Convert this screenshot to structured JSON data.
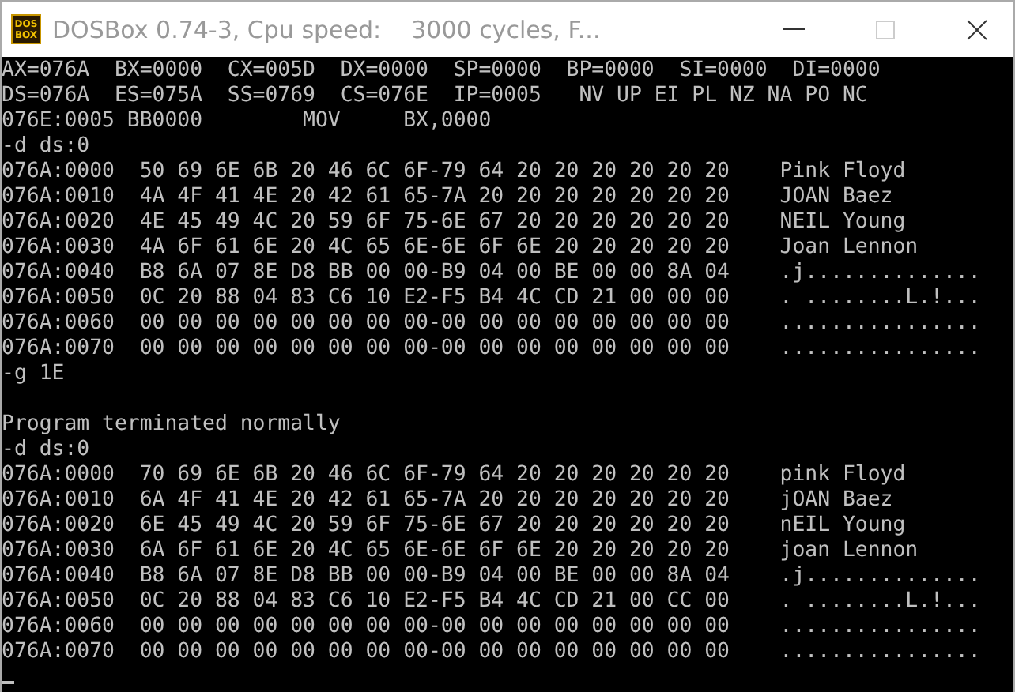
{
  "window": {
    "title": "DOSBox 0.74-3, Cpu speed:    3000 cycles, F...",
    "active": false,
    "icon_text": [
      "DOS",
      "BOX"
    ]
  },
  "blocks": [
    {
      "lines": [
        "AX=076A  BX=0000  CX=005D  DX=0000  SP=0000  BP=0000  SI=0000  DI=0000",
        "DS=076A  ES=075A  SS=0769  CS=076E  IP=0005   NV UP EI PL NZ NA PO NC",
        "076E:0005 BB0000        MOV     BX,0000",
        "-d ds:0",
        "076A:0000  50 69 6E 6B 20 46 6C 6F-79 64 20 20 20 20 20 20    Pink Floyd",
        "076A:0010  4A 4F 41 4E 20 42 61 65-7A 20 20 20 20 20 20 20    JOAN Baez",
        "076A:0020  4E 45 49 4C 20 59 6F 75-6E 67 20 20 20 20 20 20    NEIL Young",
        "076A:0030  4A 6F 61 6E 20 4C 65 6E-6E 6F 6E 20 20 20 20 20    Joan Lennon",
        "076A:0040  B8 6A 07 8E D8 BB 00 00-B9 04 00 BE 00 00 8A 04    .j..............",
        "076A:0050  0C 20 88 04 83 C6 10 E2-F5 B4 4C CD 21 00 00 00    . ........L.!...",
        "076A:0060  00 00 00 00 00 00 00 00-00 00 00 00 00 00 00 00    ................",
        "076A:0070  00 00 00 00 00 00 00 00-00 00 00 00 00 00 00 00    ................",
        "-g 1E"
      ]
    },
    {
      "lines": [
        "Program terminated normally",
        "-d ds:0",
        "076A:0000  70 69 6E 6B 20 46 6C 6F-79 64 20 20 20 20 20 20    pink Floyd",
        "076A:0010  6A 4F 41 4E 20 42 61 65-7A 20 20 20 20 20 20 20    jOAN Baez",
        "076A:0020  6E 45 49 4C 20 59 6F 75-6E 67 20 20 20 20 20 20    nEIL Young",
        "076A:0030  6A 6F 61 6E 20 4C 65 6E-6E 6F 6E 20 20 20 20 20    joan Lennon",
        "076A:0040  B8 6A 07 8E D8 BB 00 00-B9 04 00 BE 00 00 8A 04    .j..............",
        "076A:0050  0C 20 88 04 83 C6 10 E2-F5 B4 4C CD 21 00 CC 00    . ........L.!...",
        "076A:0060  00 00 00 00 00 00 00 00-00 00 00 00 00 00 00 00    ................",
        "076A:0070  00 00 00 00 00 00 00 00-00 00 00 00 00 00 00 00    ................"
      ]
    }
  ],
  "cursor_visible": true
}
